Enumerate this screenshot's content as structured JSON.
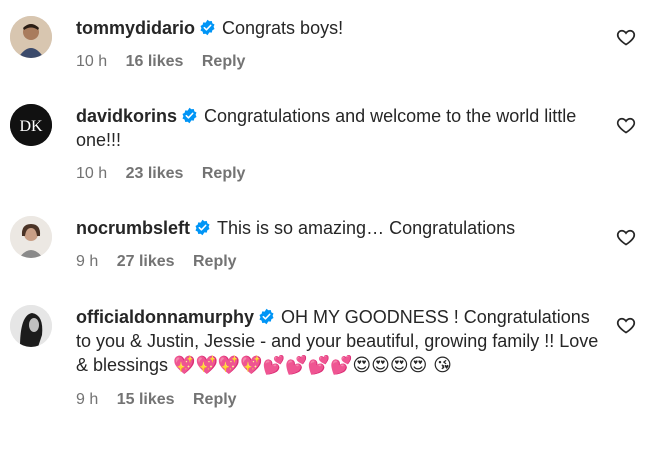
{
  "comments": [
    {
      "username": "tommydidario",
      "verified": true,
      "text": "Congrats boys!",
      "time": "10 h",
      "likes": "16 likes",
      "reply": "Reply"
    },
    {
      "username": "davidkorins",
      "verified": true,
      "text": "Congratulations and welcome to the world little one!!!",
      "time": "10 h",
      "likes": "23 likes",
      "reply": "Reply"
    },
    {
      "username": "nocrumbsleft",
      "verified": true,
      "text": "This is so amazing… Congratulations",
      "time": "9 h",
      "likes": "27 likes",
      "reply": "Reply"
    },
    {
      "username": "officialdonnamurphy",
      "verified": true,
      "text": "OH MY GOODNESS ! Congratulations to you & Justin, Jessie - and your beautiful, growing family !! Love & blessings ",
      "emojis": "💖💖💖💖💕💕💕💕😍😍😍😍 😘",
      "time": "9 h",
      "likes": "15 likes",
      "reply": "Reply"
    }
  ],
  "avatars": {
    "davidkorins_monogram": "DK"
  },
  "colors": {
    "verified_blue": "#0095f6",
    "meta_gray": "#737373",
    "text": "#262626"
  }
}
